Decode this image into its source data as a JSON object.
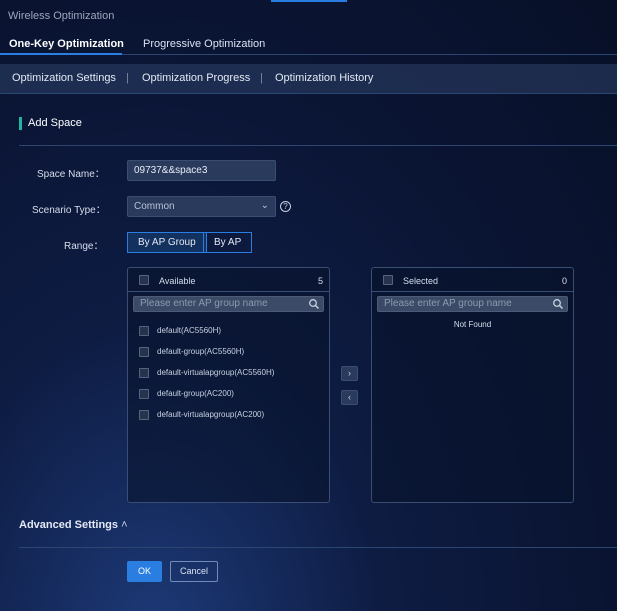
{
  "window": {
    "title": "Wireless Optimization"
  },
  "tabs": [
    {
      "label": "One-Key Optimization",
      "active": true
    },
    {
      "label": "Progressive Optimization",
      "active": false
    }
  ],
  "subnav": {
    "items": [
      "Optimization Settings",
      "Optimization Progress",
      "Optimization History"
    ],
    "separator": "|"
  },
  "section": {
    "title": "Add Space"
  },
  "form": {
    "space_name_label": "Space Name：",
    "space_name_value": "09737&&space3",
    "scenario_label": "Scenario Type：",
    "scenario_value": "Common",
    "scenario_help": "?",
    "range_label": "Range：",
    "range_options": [
      {
        "label": "By AP Group",
        "selected": true
      },
      {
        "label": "By AP",
        "selected": false
      }
    ]
  },
  "available": {
    "header": "Available",
    "count": "5",
    "search_placeholder": "Please enter AP group name",
    "items": [
      "default(AC5560H)",
      "default-group(AC5560H)",
      "default-virtualapgroup(AC5560H)",
      "default-group(AC200)",
      "default-virtualapgroup(AC200)"
    ]
  },
  "selected": {
    "header": "Selected",
    "count": "0",
    "search_placeholder": "Please enter AP group name",
    "empty_text": "Not Found"
  },
  "transfer": {
    "to_right": "›",
    "to_left": "‹"
  },
  "advanced": {
    "label": "Advanced Settings",
    "icon": "chevron-up-icon",
    "glyph": "˄"
  },
  "actions": {
    "ok": "OK",
    "cancel": "Cancel"
  },
  "colors": {
    "accent": "#2a7de1",
    "section_marker": "#1fb5a0",
    "background": "#0a1432"
  }
}
